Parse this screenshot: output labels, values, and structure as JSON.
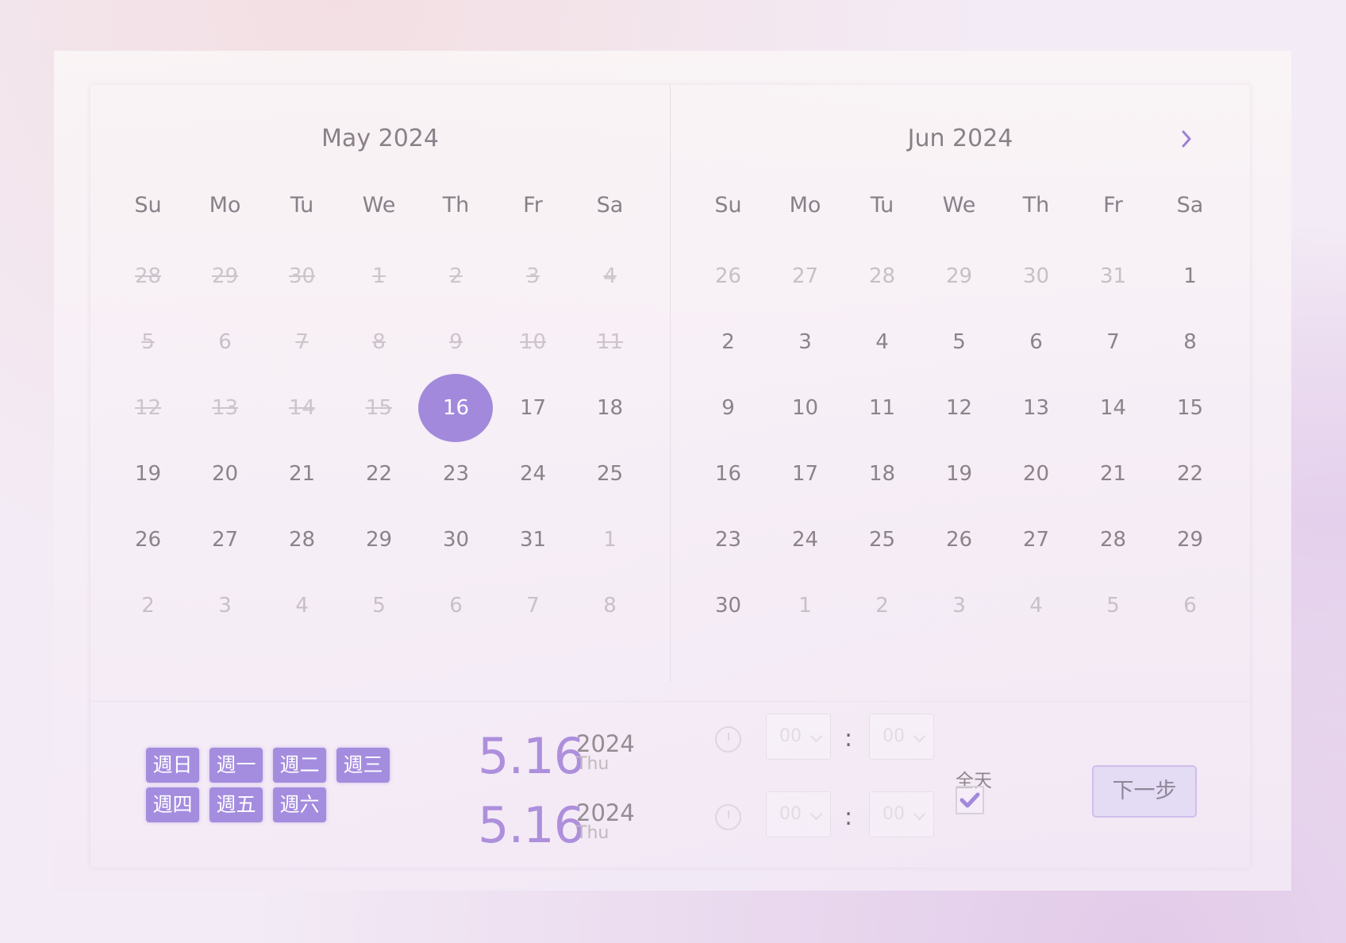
{
  "left_calendar": {
    "title": "May 2024",
    "weekdays": [
      "Su",
      "Mo",
      "Tu",
      "We",
      "Th",
      "Fr",
      "Sa"
    ],
    "weeks": [
      [
        {
          "d": "28",
          "s": "disabled"
        },
        {
          "d": "29",
          "s": "disabled"
        },
        {
          "d": "30",
          "s": "disabled"
        },
        {
          "d": "1",
          "s": "disabled"
        },
        {
          "d": "2",
          "s": "disabled"
        },
        {
          "d": "3",
          "s": "disabled"
        },
        {
          "d": "4",
          "s": "disabled"
        }
      ],
      [
        {
          "d": "5",
          "s": "disabled"
        },
        {
          "d": "6",
          "s": "muted"
        },
        {
          "d": "7",
          "s": "disabled"
        },
        {
          "d": "8",
          "s": "disabled"
        },
        {
          "d": "9",
          "s": "disabled"
        },
        {
          "d": "10",
          "s": "disabled"
        },
        {
          "d": "11",
          "s": "disabled"
        }
      ],
      [
        {
          "d": "12",
          "s": "disabled"
        },
        {
          "d": "13",
          "s": "disabled"
        },
        {
          "d": "14",
          "s": "disabled"
        },
        {
          "d": "15",
          "s": "disabled"
        },
        {
          "d": "16",
          "s": "selected"
        },
        {
          "d": "17",
          "s": "normal"
        },
        {
          "d": "18",
          "s": "normal"
        }
      ],
      [
        {
          "d": "19",
          "s": "normal"
        },
        {
          "d": "20",
          "s": "normal"
        },
        {
          "d": "21",
          "s": "normal"
        },
        {
          "d": "22",
          "s": "normal"
        },
        {
          "d": "23",
          "s": "normal"
        },
        {
          "d": "24",
          "s": "normal"
        },
        {
          "d": "25",
          "s": "normal"
        }
      ],
      [
        {
          "d": "26",
          "s": "normal"
        },
        {
          "d": "27",
          "s": "normal"
        },
        {
          "d": "28",
          "s": "normal"
        },
        {
          "d": "29",
          "s": "normal"
        },
        {
          "d": "30",
          "s": "normal"
        },
        {
          "d": "31",
          "s": "normal"
        },
        {
          "d": "1",
          "s": "muted"
        }
      ],
      [
        {
          "d": "2",
          "s": "muted"
        },
        {
          "d": "3",
          "s": "muted"
        },
        {
          "d": "4",
          "s": "muted"
        },
        {
          "d": "5",
          "s": "muted"
        },
        {
          "d": "6",
          "s": "muted"
        },
        {
          "d": "7",
          "s": "muted"
        },
        {
          "d": "8",
          "s": "muted"
        }
      ]
    ]
  },
  "right_calendar": {
    "title": "Jun 2024",
    "next_icon": "chevron-right-icon",
    "weekdays": [
      "Su",
      "Mo",
      "Tu",
      "We",
      "Th",
      "Fr",
      "Sa"
    ],
    "weeks": [
      [
        {
          "d": "26",
          "s": "muted"
        },
        {
          "d": "27",
          "s": "muted"
        },
        {
          "d": "28",
          "s": "muted"
        },
        {
          "d": "29",
          "s": "muted"
        },
        {
          "d": "30",
          "s": "muted"
        },
        {
          "d": "31",
          "s": "muted"
        },
        {
          "d": "1",
          "s": "normal"
        }
      ],
      [
        {
          "d": "2",
          "s": "normal"
        },
        {
          "d": "3",
          "s": "normal"
        },
        {
          "d": "4",
          "s": "normal"
        },
        {
          "d": "5",
          "s": "normal"
        },
        {
          "d": "6",
          "s": "normal"
        },
        {
          "d": "7",
          "s": "normal"
        },
        {
          "d": "8",
          "s": "normal"
        }
      ],
      [
        {
          "d": "9",
          "s": "normal"
        },
        {
          "d": "10",
          "s": "normal"
        },
        {
          "d": "11",
          "s": "normal"
        },
        {
          "d": "12",
          "s": "normal"
        },
        {
          "d": "13",
          "s": "normal"
        },
        {
          "d": "14",
          "s": "normal"
        },
        {
          "d": "15",
          "s": "normal"
        }
      ],
      [
        {
          "d": "16",
          "s": "normal"
        },
        {
          "d": "17",
          "s": "normal"
        },
        {
          "d": "18",
          "s": "normal"
        },
        {
          "d": "19",
          "s": "normal"
        },
        {
          "d": "20",
          "s": "normal"
        },
        {
          "d": "21",
          "s": "normal"
        },
        {
          "d": "22",
          "s": "normal"
        }
      ],
      [
        {
          "d": "23",
          "s": "normal"
        },
        {
          "d": "24",
          "s": "normal"
        },
        {
          "d": "25",
          "s": "normal"
        },
        {
          "d": "26",
          "s": "normal"
        },
        {
          "d": "27",
          "s": "normal"
        },
        {
          "d": "28",
          "s": "normal"
        },
        {
          "d": "29",
          "s": "normal"
        }
      ],
      [
        {
          "d": "30",
          "s": "normal"
        },
        {
          "d": "1",
          "s": "muted"
        },
        {
          "d": "2",
          "s": "muted"
        },
        {
          "d": "3",
          "s": "muted"
        },
        {
          "d": "4",
          "s": "muted"
        },
        {
          "d": "5",
          "s": "muted"
        },
        {
          "d": "6",
          "s": "muted"
        }
      ]
    ]
  },
  "weekday_buttons": [
    "週日",
    "週一",
    "週二",
    "週三",
    "週四",
    "週五",
    "週六"
  ],
  "start": {
    "date": "5.16",
    "year": "2024",
    "dow": "Thu",
    "hour": "00",
    "minute": "00"
  },
  "end": {
    "date": "5.16",
    "year": "2024",
    "dow": "Thu",
    "hour": "00",
    "minute": "00"
  },
  "time_colon": ":",
  "all_day": {
    "label": "全天",
    "checked": true
  },
  "next_step_label": "下一步",
  "colors": {
    "accent": "#a389dc",
    "accent_button": "#a48cdf",
    "date_text": "#ad8fdc"
  }
}
